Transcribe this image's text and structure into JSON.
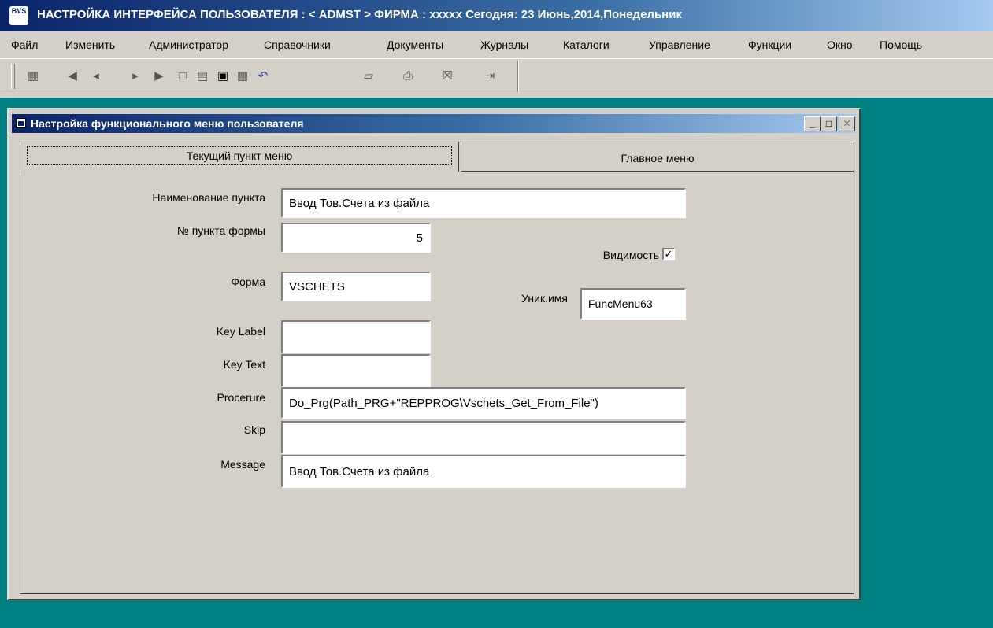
{
  "app": {
    "icon_text": "BVS",
    "title": "НАСТРОЙКА ИНТЕРФЕЙСА ПОЛЬЗОВАТЕЛЯ :  < ADMST > ФИРМА : xxxxx   Сегодня: 23 Июнь,2014,Понедельник"
  },
  "menubar": {
    "items": [
      "Файл",
      "Изменить",
      "Администратор",
      "Справочники",
      "Документы",
      "Журналы",
      "Каталоги",
      "Управление",
      "Функции",
      "Окно",
      "Помощь"
    ]
  },
  "toolbar": {
    "icons": [
      "users-icon",
      "first-record-icon",
      "prev-record-icon",
      "next-record-icon",
      "last-record-icon",
      "new-document-icon",
      "edit-icon",
      "save-icon",
      "find-icon",
      "undo-icon",
      "network-icon",
      "print-icon",
      "excel-icon",
      "exit-icon"
    ]
  },
  "child_window": {
    "title": "Настройка функционального меню пользователя",
    "minimize": "_",
    "maximize": "□",
    "close": "✕"
  },
  "tabs": {
    "current": "Текущий пункт меню",
    "main": "Главное меню"
  },
  "form": {
    "item_name_label": "Наименование пункта",
    "item_name_value": "Ввод Тов.Счета из файла",
    "form_item_no_label": "№ пункта формы",
    "form_item_no_value": "5",
    "visibility_label": "Видимость",
    "visibility_checked": true,
    "form_label": "Форма",
    "form_value": "VSCHETS",
    "unique_name_label": "Уник.имя",
    "unique_name_value": "FuncMenu63",
    "key_label_label": "Key Label",
    "key_label_value": "",
    "key_text_label": "Key Text",
    "key_text_value": "",
    "procedure_label": "Procerure",
    "procedure_value": "Do_Prg(Path_PRG+\"REPPROG\\Vschets_Get_From_File\")",
    "skip_label": "Skip",
    "skip_value": "",
    "message_label": "Message",
    "message_value": "Ввод Тов.Счета из файла"
  }
}
